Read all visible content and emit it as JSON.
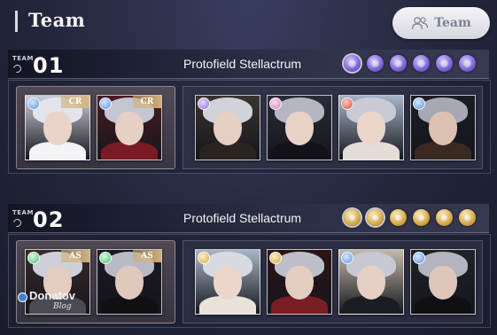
{
  "header": {
    "title": "Team",
    "team_button_label": "Team",
    "team_button_icon": "team-people-icon"
  },
  "teams": [
    {
      "tag": "TEAM",
      "number": "01",
      "name": "Protofield Stellactrum",
      "gem_color": "#8a70e0",
      "gems": [
        {
          "active": true
        },
        {
          "active": false
        },
        {
          "active": false
        },
        {
          "active": false
        },
        {
          "active": false
        },
        {
          "active": false
        }
      ],
      "supports": [
        {
          "rarity": "CR",
          "gem": "blue",
          "hair": "#e2e4ec",
          "skin": "#ead4c8",
          "cloth": "#f4f4f6",
          "bg": "#c9ccd8"
        },
        {
          "rarity": "CR",
          "gem": "blue",
          "hair": "#c4c6d2",
          "skin": "#e6cfc4",
          "cloth": "#7a1a24",
          "bg": "#4a1c22"
        }
      ],
      "mains": [
        {
          "gem": "purple",
          "hair": "#d0d2da",
          "skin": "#e5cec2",
          "cloth": "#2a2420",
          "bg": "#3a3430"
        },
        {
          "gem": "pink",
          "hair": "#b4b6c2",
          "skin": "#e8d1c6",
          "cloth": "#121218",
          "bg": "#2a2c36"
        },
        {
          "gem": "red",
          "hair": "#c8cad4",
          "skin": "#ecd6cc",
          "cloth": "#e4dcd6",
          "bg": "#a6b4c8"
        },
        {
          "gem": "blue",
          "hair": "#a6a8b4",
          "skin": "#dcc0b0",
          "cloth": "#3a2a22",
          "bg": "#1c1c24"
        }
      ]
    },
    {
      "tag": "TEAM",
      "number": "02",
      "name": "Protofield Stellactrum",
      "gem_color": "#d4a43e",
      "gems": [
        {
          "active": true
        },
        {
          "active": true
        },
        {
          "active": false
        },
        {
          "active": false
        },
        {
          "active": false
        },
        {
          "active": false
        }
      ],
      "supports": [
        {
          "rarity": "AS",
          "gem": "green",
          "hair": "#cdd0da",
          "skin": "#e4ccc0",
          "cloth": "#4a4a52",
          "bg": "#3a2a2c"
        },
        {
          "rarity": "AS",
          "gem": "green",
          "hair": "#b8bac6",
          "skin": "#e0c8bc",
          "cloth": "#101014",
          "bg": "#1a1a20"
        }
      ],
      "mains": [
        {
          "gem": "gold",
          "hair": "#d8dae2",
          "skin": "#ecd6cc",
          "cloth": "#e8e2d8",
          "bg": "#a8b6c6"
        },
        {
          "gem": "gold",
          "hair": "#bcbec8",
          "skin": "#e4ccc0",
          "cloth": "#7a1e26",
          "bg": "#2c1416"
        },
        {
          "gem": "blue",
          "hair": "#c6c8d2",
          "skin": "#e6cfc4",
          "cloth": "#1c1c24",
          "bg": "#c4b8ac"
        },
        {
          "gem": "blue",
          "hair": "#b2b4be",
          "skin": "#dfc6ba",
          "cloth": "#101014",
          "bg": "#202228"
        }
      ]
    }
  ],
  "watermark": {
    "name": "Donatov",
    "sub": "Blog"
  }
}
